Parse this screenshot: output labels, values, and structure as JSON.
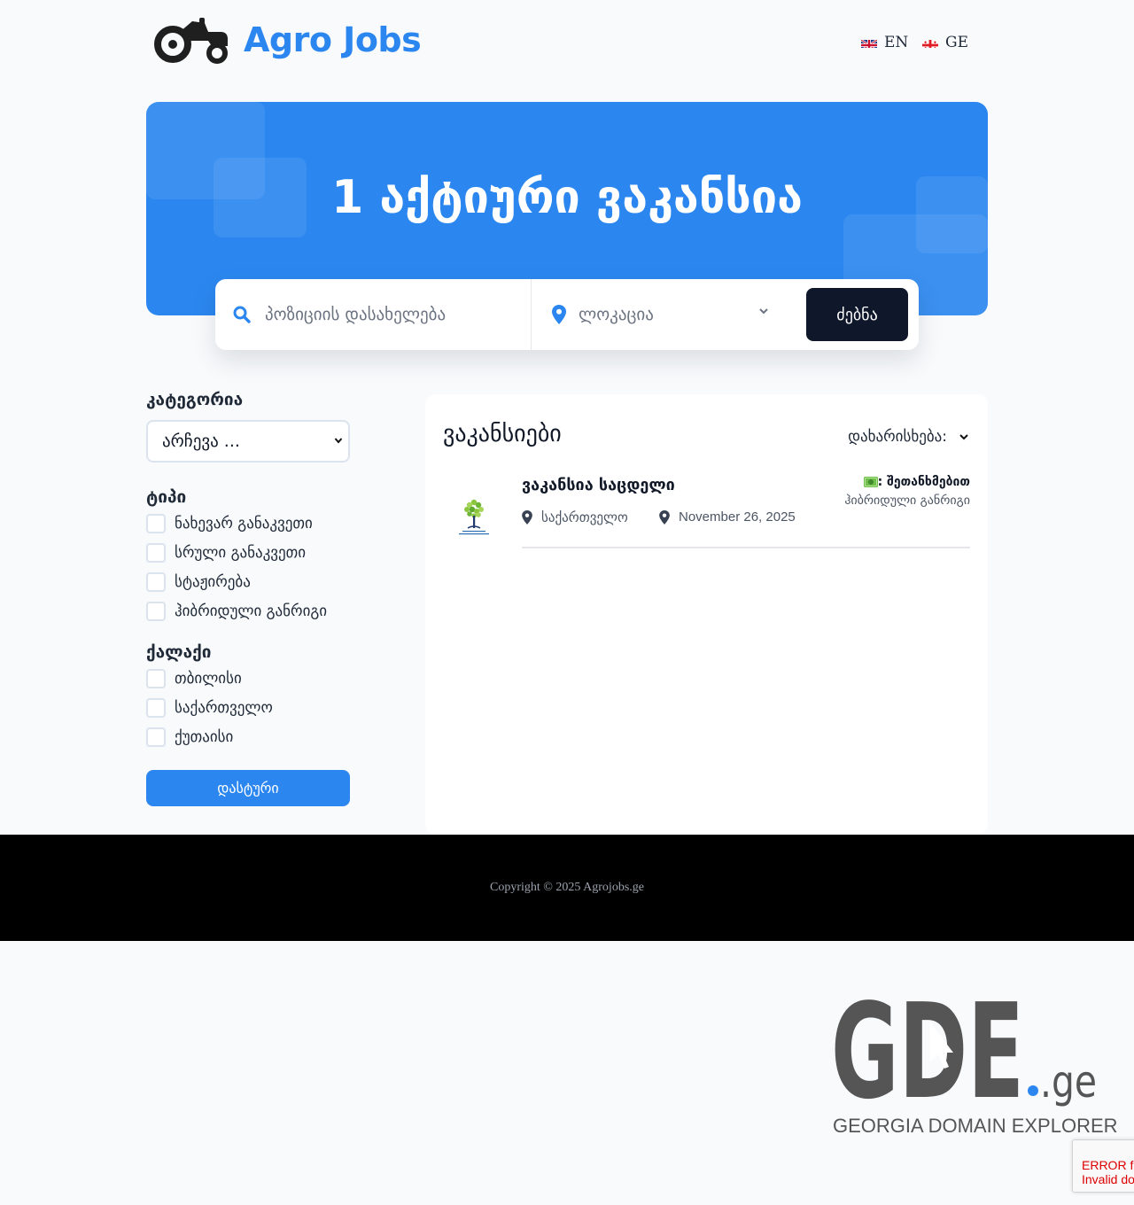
{
  "brand": {
    "name": "Agro Jobs",
    "accent": "#2b87ef"
  },
  "languages": [
    {
      "code": "EN",
      "flag": "uk-flag-icon"
    },
    {
      "code": "GE",
      "flag": "georgia-flag-icon"
    }
  ],
  "hero": {
    "title": "1 აქტიური ვაკანსია",
    "color": "#2b87ef"
  },
  "search": {
    "position_placeholder": "პოზიციის დასახელება",
    "location_placeholder": "ლოკაცია",
    "button": "ძებნა"
  },
  "sidebar": {
    "category_heading": "კატეგორია",
    "category_select": "არჩევა ...",
    "type_heading": "ტიპი",
    "types": [
      "ნახევარ განაკვეთი",
      "სრული განაკვეთი",
      "სტაჟირება",
      "ჰიბრიდული განრიგი"
    ],
    "city_heading": "ქალაქი",
    "cities": [
      "თბილისი",
      "საქართველო",
      "ქუთაისი"
    ],
    "filter_button": "დასტური"
  },
  "listings": {
    "heading": "ვაკანსიები",
    "sort_label": "დახარისხება:",
    "jobs": [
      {
        "title": "ვაკანსია საცდელი",
        "location": "საქართველო",
        "date": "November 26, 2025",
        "salary_icon": "money-icon",
        "salary": ": შეთანხმებით",
        "type": "ჰიბრიდული განრიგი"
      }
    ]
  },
  "footer": {
    "copyright": "Copyright © 2025 Agrojobs.ge"
  },
  "gde": {
    "main": "GDE",
    "tld": ".ge",
    "subtitle": "GEORGIA DOMAIN EXPLORER"
  },
  "recaptcha": {
    "line1": "ERROR f",
    "line2": "Invalid do"
  }
}
